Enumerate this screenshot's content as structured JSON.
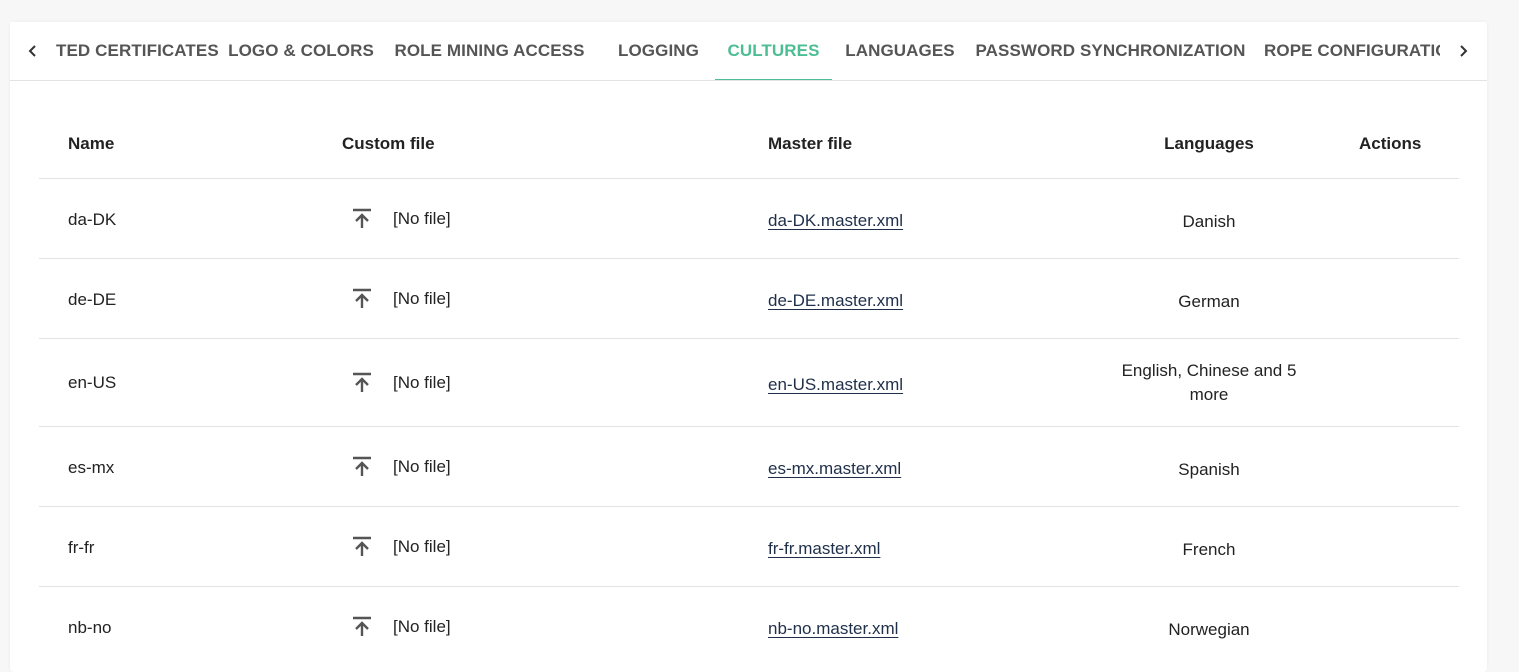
{
  "tabs": [
    {
      "label": "TED CERTIFICATES"
    },
    {
      "label": "LOGO & COLORS"
    },
    {
      "label": "ROLE MINING ACCESS"
    },
    {
      "label": "LOGGING"
    },
    {
      "label": "CULTURES"
    },
    {
      "label": "LANGUAGES"
    },
    {
      "label": "PASSWORD SYNCHRONIZATION"
    },
    {
      "label": "ROPE CONFIGURATION"
    }
  ],
  "active_tab": "CULTURES",
  "colors": {
    "accent": "#4dbd94",
    "link": "#1f2f4a"
  },
  "table": {
    "headers": {
      "name": "Name",
      "custom_file": "Custom file",
      "master_file": "Master file",
      "languages": "Languages",
      "actions": "Actions"
    },
    "rows": [
      {
        "name": "da-DK",
        "custom_file": "[No file]",
        "master_file": "da-DK.master.xml",
        "languages": "Danish"
      },
      {
        "name": "de-DE",
        "custom_file": "[No file]",
        "master_file": "de-DE.master.xml",
        "languages": "German"
      },
      {
        "name": "en-US",
        "custom_file": "[No file]",
        "master_file": "en-US.master.xml",
        "languages": "English, Chinese and 5 more"
      },
      {
        "name": "es-mx",
        "custom_file": "[No file]",
        "master_file": "es-mx.master.xml",
        "languages": "Spanish"
      },
      {
        "name": "fr-fr",
        "custom_file": "[No file]",
        "master_file": "fr-fr.master.xml",
        "languages": "French"
      },
      {
        "name": "nb-no",
        "custom_file": "[No file]",
        "master_file": "nb-no.master.xml",
        "languages": "Norwegian"
      }
    ]
  },
  "icons": {
    "tab_prev": "chevron-left-icon",
    "tab_next": "chevron-right-icon",
    "upload": "upload-icon"
  }
}
